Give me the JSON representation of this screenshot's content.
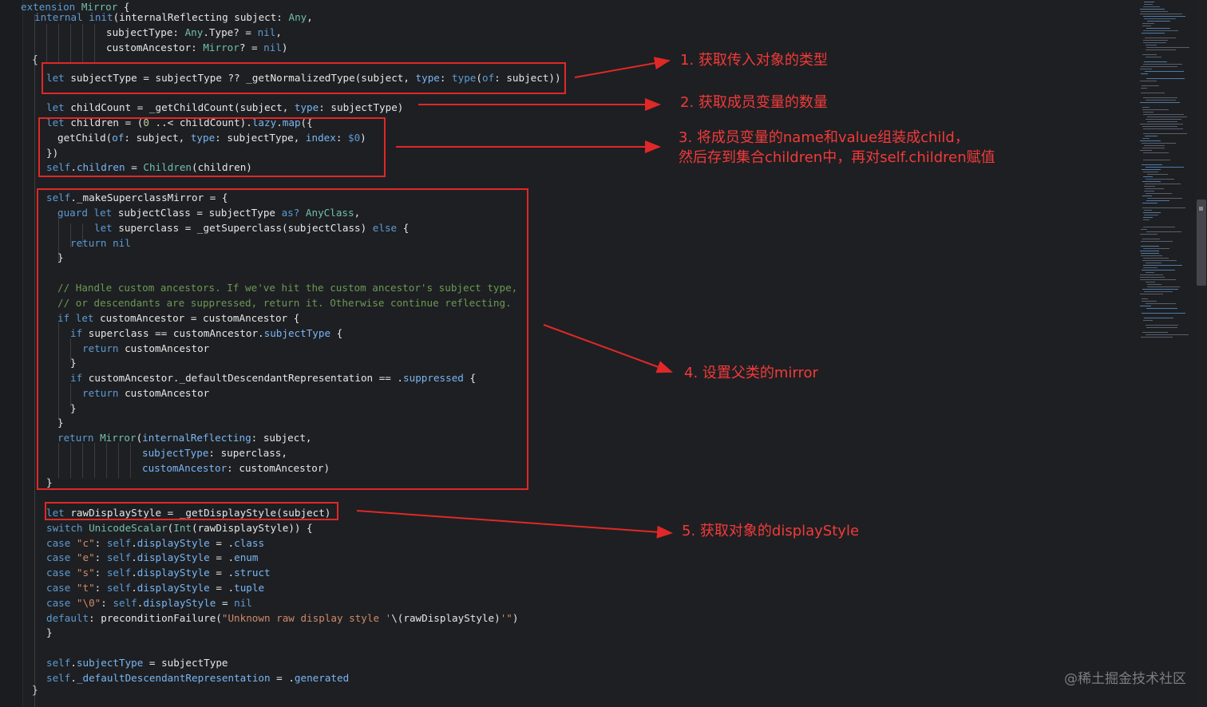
{
  "editor": {
    "colors": {
      "background": "#1e1f22",
      "plain": "#e6e6e6",
      "keyword": "#5b9bd5",
      "type": "#6fc0a9",
      "member": "#78b6f5",
      "string": "#cf8a6b",
      "comment": "#6a9955",
      "number": "#b5cea8",
      "annotation_red": "#e02828"
    },
    "code_lines": [
      [
        [
          "k",
          "extension "
        ],
        [
          "t",
          "Mirror"
        ],
        [
          "p",
          " {"
        ]
      ],
      [
        [
          "k",
          "internal "
        ],
        [
          "k",
          "init"
        ],
        [
          "p",
          "(internalReflecting subject: "
        ],
        [
          "t",
          "Any"
        ],
        [
          "p",
          ","
        ]
      ],
      [
        [
          "p",
          "subjectType: "
        ],
        [
          "t",
          "Any"
        ],
        [
          "p",
          ".Type? = "
        ],
        [
          "k",
          "nil"
        ],
        [
          "p",
          ","
        ]
      ],
      [
        [
          "p",
          "customAncestor: "
        ],
        [
          "t",
          "Mirror"
        ],
        [
          "p",
          "? = "
        ],
        [
          "k",
          "nil"
        ],
        [
          "p",
          ")"
        ]
      ],
      [
        [
          "k",
          "let "
        ],
        [
          "p",
          "subjectType = subjectType ?? _getNormalizedType(subject, "
        ],
        [
          "m",
          "type"
        ],
        [
          "p",
          ": "
        ],
        [
          "k",
          "type"
        ],
        [
          "p",
          "("
        ],
        [
          "k",
          "of"
        ],
        [
          "p",
          ": subject))"
        ]
      ],
      [
        [
          "k",
          "let "
        ],
        [
          "p",
          "childCount = _getChildCount(subject, "
        ],
        [
          "m",
          "type"
        ],
        [
          "p",
          ": subjectType)"
        ]
      ],
      [
        [
          "k",
          "let "
        ],
        [
          "p",
          "children = ("
        ],
        [
          "n",
          "0"
        ],
        [
          "p",
          " ..< childCount)."
        ],
        [
          "m",
          "lazy"
        ],
        [
          "p",
          "."
        ],
        [
          "m",
          "map"
        ],
        [
          "p",
          "({"
        ]
      ],
      [
        [
          "p",
          "getChild("
        ],
        [
          "m",
          "of"
        ],
        [
          "p",
          ": subject, "
        ],
        [
          "m",
          "type"
        ],
        [
          "p",
          ": subjectType, "
        ],
        [
          "m",
          "index"
        ],
        [
          "p",
          ": "
        ],
        [
          "k",
          "$0"
        ],
        [
          "p",
          ")"
        ]
      ],
      [
        [
          "p",
          "})"
        ]
      ],
      [
        [
          "k",
          "self"
        ],
        [
          "p",
          "."
        ],
        [
          "m",
          "children"
        ],
        [
          "p",
          " = "
        ],
        [
          "t",
          "Children"
        ],
        [
          "p",
          "(children)"
        ]
      ],
      [
        [
          "k",
          "self"
        ],
        [
          "p",
          "._makeSuperclassMirror = {"
        ]
      ],
      [
        [
          "k",
          "guard "
        ],
        [
          "k",
          "let "
        ],
        [
          "p",
          "subjectClass = subjectType "
        ],
        [
          "k",
          "as? "
        ],
        [
          "t",
          "AnyClass"
        ],
        [
          "p",
          ","
        ]
      ],
      [
        [
          "k",
          "let "
        ],
        [
          "p",
          "superclass = _getSuperclass(subjectClass) "
        ],
        [
          "k",
          "else"
        ],
        [
          "p",
          " {"
        ]
      ],
      [
        [
          "k",
          "return "
        ],
        [
          "k",
          "nil"
        ]
      ],
      [
        [
          "p",
          "}"
        ]
      ],
      [
        [
          "c",
          "// Handle custom ancestors. If we've hit the custom ancestor's subject type,"
        ]
      ],
      [
        [
          "c",
          "// or descendants are suppressed, return it. Otherwise continue reflecting."
        ]
      ],
      [
        [
          "k",
          "if "
        ],
        [
          "k",
          "let "
        ],
        [
          "p",
          "customAncestor = customAncestor {"
        ]
      ],
      [
        [
          "k",
          "if "
        ],
        [
          "p",
          "superclass == customAncestor."
        ],
        [
          "m",
          "subjectType"
        ],
        [
          "p",
          " {"
        ]
      ],
      [
        [
          "k",
          "return "
        ],
        [
          "p",
          "customAncestor"
        ]
      ],
      [
        [
          "p",
          "}"
        ]
      ],
      [
        [
          "k",
          "if "
        ],
        [
          "p",
          "customAncestor._defaultDescendantRepresentation == ."
        ],
        [
          "m",
          "suppressed"
        ],
        [
          "p",
          " {"
        ]
      ],
      [
        [
          "k",
          "return "
        ],
        [
          "p",
          "customAncestor"
        ]
      ],
      [
        [
          "p",
          "}"
        ]
      ],
      [
        [
          "p",
          "}"
        ]
      ],
      [
        [
          "k",
          "return "
        ],
        [
          "t",
          "Mirror"
        ],
        [
          "p",
          "("
        ],
        [
          "m",
          "internalReflecting"
        ],
        [
          "p",
          ": subject,"
        ]
      ],
      [
        [
          "m",
          "subjectType"
        ],
        [
          "p",
          ": superclass,"
        ]
      ],
      [
        [
          "m",
          "customAncestor"
        ],
        [
          "p",
          ": customAncestor)"
        ]
      ],
      [
        [
          "p",
          "}"
        ]
      ],
      [
        [
          "k",
          "let "
        ],
        [
          "p",
          "rawDisplayStyle = _getDisplayStyle(subject)"
        ]
      ],
      [
        [
          "k",
          "switch "
        ],
        [
          "t",
          "UnicodeScalar"
        ],
        [
          "p",
          "("
        ],
        [
          "t",
          "Int"
        ],
        [
          "p",
          "(rawDisplayStyle)) {"
        ]
      ],
      [
        [
          "k",
          "case "
        ],
        [
          "s",
          "\"c\""
        ],
        [
          "p",
          ": "
        ],
        [
          "k",
          "self"
        ],
        [
          "p",
          "."
        ],
        [
          "m",
          "displayStyle"
        ],
        [
          "p",
          " = ."
        ],
        [
          "m",
          "class"
        ]
      ],
      [
        [
          "k",
          "case "
        ],
        [
          "s",
          "\"e\""
        ],
        [
          "p",
          ": "
        ],
        [
          "k",
          "self"
        ],
        [
          "p",
          "."
        ],
        [
          "m",
          "displayStyle"
        ],
        [
          "p",
          " = ."
        ],
        [
          "m",
          "enum"
        ]
      ],
      [
        [
          "k",
          "case "
        ],
        [
          "s",
          "\"s\""
        ],
        [
          "p",
          ": "
        ],
        [
          "k",
          "self"
        ],
        [
          "p",
          "."
        ],
        [
          "m",
          "displayStyle"
        ],
        [
          "p",
          " = ."
        ],
        [
          "m",
          "struct"
        ]
      ],
      [
        [
          "k",
          "case "
        ],
        [
          "s",
          "\"t\""
        ],
        [
          "p",
          ": "
        ],
        [
          "k",
          "self"
        ],
        [
          "p",
          "."
        ],
        [
          "m",
          "displayStyle"
        ],
        [
          "p",
          " = ."
        ],
        [
          "m",
          "tuple"
        ]
      ],
      [
        [
          "k",
          "case "
        ],
        [
          "s",
          "\"\\0\""
        ],
        [
          "p",
          ": "
        ],
        [
          "k",
          "self"
        ],
        [
          "p",
          "."
        ],
        [
          "m",
          "displayStyle"
        ],
        [
          "p",
          " = "
        ],
        [
          "k",
          "nil"
        ]
      ],
      [
        [
          "k",
          "default"
        ],
        [
          "p",
          ": preconditionFailure("
        ],
        [
          "s",
          "\"Unknown raw display style '"
        ],
        [
          "p",
          "\\(rawDisplayStyle)"
        ],
        [
          "s",
          "'\""
        ],
        [
          "p",
          ")"
        ]
      ],
      [
        [
          "p",
          "}"
        ]
      ],
      [
        [
          "k",
          "self"
        ],
        [
          "p",
          "."
        ],
        [
          "m",
          "subjectType"
        ],
        [
          "p",
          " = subjectType"
        ]
      ],
      [
        [
          "k",
          "self"
        ],
        [
          "p",
          "."
        ],
        [
          "m",
          "_defaultDescendantRepresentation"
        ],
        [
          "p",
          " = ."
        ],
        [
          "m",
          "generated"
        ]
      ]
    ],
    "annotations": [
      "1. 获取传入对象的类型",
      "2. 获取成员变量的数量",
      "3. 将成员变量的name和value组装成child，",
      "然后存到集合children中，再对self.children赋值",
      "4. 设置父类的mirror",
      "5. 获取对象的displayStyle"
    ],
    "brace_open": "{",
    "brace_close": "}",
    "watermark": "@稀土掘金技术社区"
  }
}
